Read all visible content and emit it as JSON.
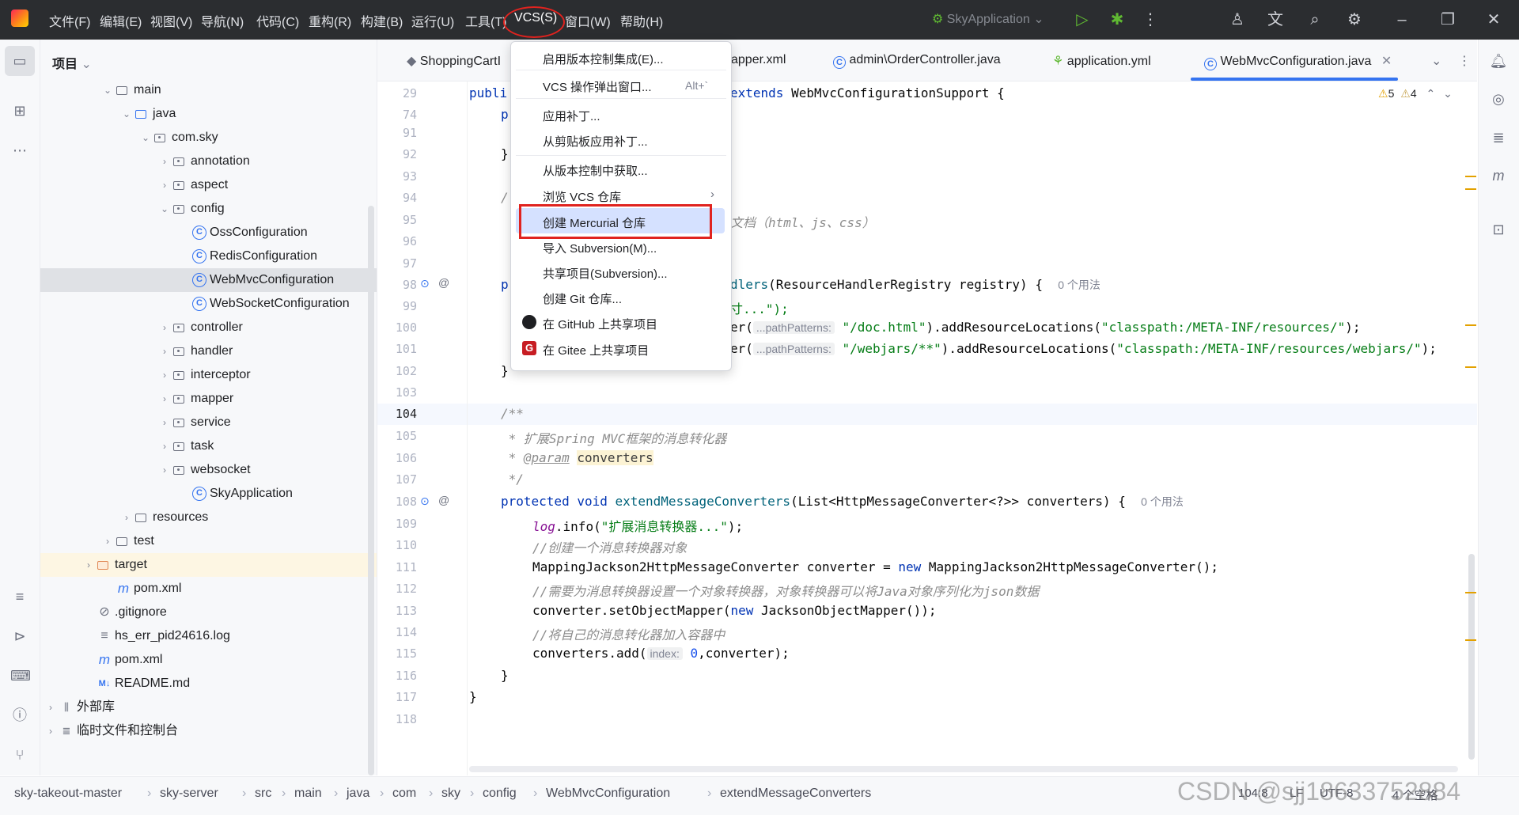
{
  "menubar": {
    "items": [
      "文件(F)",
      "编辑(E)",
      "视图(V)",
      "导航(N)",
      "代码(C)",
      "重构(R)",
      "构建(B)",
      "运行(U)",
      "工具(T)",
      "VCS(S)",
      "窗口(W)",
      "帮助(H)"
    ],
    "run_config": "SkyApplication"
  },
  "project_panel": {
    "title": "项目",
    "tree": [
      {
        "label": "main",
        "depth": 4,
        "icon": "folder",
        "expanded": true
      },
      {
        "label": "java",
        "depth": 5,
        "icon": "folder-blue",
        "expanded": true
      },
      {
        "label": "com.sky",
        "depth": 6,
        "icon": "package",
        "expanded": true
      },
      {
        "label": "annotation",
        "depth": 7,
        "icon": "package",
        "expanded": false
      },
      {
        "label": "aspect",
        "depth": 7,
        "icon": "package",
        "expanded": false
      },
      {
        "label": "config",
        "depth": 7,
        "icon": "package",
        "expanded": true
      },
      {
        "label": "OssConfiguration",
        "depth": 8,
        "icon": "class"
      },
      {
        "label": "RedisConfiguration",
        "depth": 8,
        "icon": "class"
      },
      {
        "label": "WebMvcConfiguration",
        "depth": 8,
        "icon": "class",
        "selected": true
      },
      {
        "label": "WebSocketConfiguration",
        "depth": 8,
        "icon": "class"
      },
      {
        "label": "controller",
        "depth": 7,
        "icon": "package",
        "expanded": false
      },
      {
        "label": "handler",
        "depth": 7,
        "icon": "package",
        "expanded": false
      },
      {
        "label": "interceptor",
        "depth": 7,
        "icon": "package",
        "expanded": false
      },
      {
        "label": "mapper",
        "depth": 7,
        "icon": "package",
        "expanded": false
      },
      {
        "label": "service",
        "depth": 7,
        "icon": "package",
        "expanded": false
      },
      {
        "label": "task",
        "depth": 7,
        "icon": "package",
        "expanded": false
      },
      {
        "label": "websocket",
        "depth": 7,
        "icon": "package",
        "expanded": false
      },
      {
        "label": "SkyApplication",
        "depth": 8,
        "icon": "class-run"
      },
      {
        "label": "resources",
        "depth": 5,
        "icon": "folder",
        "expanded": false
      },
      {
        "label": "test",
        "depth": 4,
        "icon": "folder",
        "expanded": false
      },
      {
        "label": "target",
        "depth": 3,
        "icon": "folder-orange",
        "expanded": false,
        "highlight": true
      },
      {
        "label": "pom.xml",
        "depth": 4,
        "icon": "maven"
      },
      {
        "label": ".gitignore",
        "depth": 3,
        "icon": "ignore"
      },
      {
        "label": "hs_err_pid24616.log",
        "depth": 3,
        "icon": "text"
      },
      {
        "label": "pom.xml",
        "depth": 3,
        "icon": "maven"
      },
      {
        "label": "README.md",
        "depth": 3,
        "icon": "markdown"
      },
      {
        "label": "外部库",
        "depth": 1,
        "icon": "library",
        "expanded": false
      },
      {
        "label": "临时文件和控制台",
        "depth": 1,
        "icon": "scratch",
        "expanded": false
      }
    ]
  },
  "tabs": [
    {
      "label": "ShoppingCartI",
      "icon": "file"
    },
    {
      "label": "apper.xml",
      "icon": "xml"
    },
    {
      "label": "admin\\OrderController.java",
      "icon": "class"
    },
    {
      "label": "application.yml",
      "icon": "yml"
    },
    {
      "label": "WebMvcConfiguration.java",
      "icon": "class",
      "active": true
    }
  ],
  "inspections": {
    "warnings": "5",
    "weak_warnings": "4"
  },
  "vcs_menu": {
    "items": [
      {
        "label": "启用版本控制集成(E)...",
        "shortcut": ""
      },
      {
        "label": "VCS 操作弹出窗口...",
        "shortcut": "Alt+`"
      },
      {
        "label": "应用补丁...",
        "shortcut": ""
      },
      {
        "label": "从剪贴板应用补丁...",
        "shortcut": ""
      },
      {
        "label": "从版本控制中获取...",
        "shortcut": ""
      },
      {
        "label": "浏览 VCS 仓库",
        "shortcut": "›"
      },
      {
        "label": "创建 Mercurial 仓库",
        "shortcut": "",
        "highlight": true
      },
      {
        "label": "导入 Subversion(M)...",
        "shortcut": ""
      },
      {
        "label": "共享项目(Subversion)...",
        "shortcut": ""
      },
      {
        "label": "创建 Git 仓库...",
        "shortcut": ""
      },
      {
        "label": "在 GitHub 上共享项目",
        "shortcut": "",
        "icon": "github"
      },
      {
        "label": "在 Gitee 上共享项目",
        "shortcut": "",
        "icon": "gitee"
      }
    ]
  },
  "code": {
    "line_numbers": [
      "29",
      "74",
      "91",
      "92",
      "93",
      "94",
      "95",
      "96",
      "97",
      "98",
      "99",
      "100",
      "101",
      "102",
      "103",
      "104",
      "105",
      "106",
      "107",
      "108",
      "109",
      "110",
      "111",
      "112",
      "113",
      "114",
      "115",
      "116",
      "117",
      "118"
    ],
    "l29_a": "publi",
    "l29_b": "extends",
    "l29_c": " WebMvcConfigurationSupport {",
    "l74": "p",
    "l92": "}",
    "l94": "/",
    "l95": "文档（html、js、css）",
    "l98_a": "p",
    "l98_b": "dlers",
    "l98_c": "(ResourceHandlerRegistry registry) {",
    "l98_usages": "0 个用法",
    "l99": "寸...\");",
    "l100_a": "er(",
    "l100_hint": "...pathPatterns:",
    "l100_b": "\"/doc.html\"",
    "l100_c": ").addResourceLocations(",
    "l100_d": "\"classpath:/META-INF/resources/\"",
    "l100_e": ");",
    "l101_a": "er(",
    "l101_hint": "...pathPatterns:",
    "l101_b": "\"/webjars/**\"",
    "l101_c": ").addResourceLocations(",
    "l101_d": "\"classpath:/META-INF/resources/webjars/\"",
    "l101_e": ");",
    "l102": "}",
    "l104": "/**",
    "l105": " * 扩展Spring MVC框架的消息转化器",
    "l106_a": " * ",
    "l106_b": "@param",
    "l106_c": "converters",
    "l107": " */",
    "l108_a": "protected void ",
    "l108_b": "extendMessageConverters",
    "l108_c": "(List<HttpMessageConverter<?>> converters) {",
    "l108_usages": "0 个用法",
    "l109_a": "log",
    "l109_b": ".info(",
    "l109_c": "\"扩展消息转换器...\"",
    "l109_d": ");",
    "l110": "//创建一个消息转换器对象",
    "l111_a": "MappingJackson2HttpMessageConverter converter = ",
    "l111_b": "new",
    "l111_c": " MappingJackson2HttpMessageConverter();",
    "l112": "//需要为消息转换器设置一个对象转换器，对象转换器可以将Java对象序列化为json数据",
    "l113_a": "converter.setObjectMapper(",
    "l113_b": "new",
    "l113_c": " JacksonObjectMapper());",
    "l114": "//将自己的消息转化器加入容器中",
    "l115_a": "converters.add(",
    "l115_hint": "index:",
    "l115_b": "0",
    "l115_c": ",converter);",
    "l116": "}",
    "l117": "}"
  },
  "breadcrumb": [
    "sky-takeout-master",
    "sky-server",
    "src",
    "main",
    "java",
    "com",
    "sky",
    "config",
    "WebMvcConfiguration",
    "extendMessageConverters"
  ],
  "status": {
    "position": "104:8",
    "line_sep": "LF",
    "encoding": "UTF-8",
    "indent": "4 个空格"
  },
  "watermark": "CSDN @sjj18633752884"
}
